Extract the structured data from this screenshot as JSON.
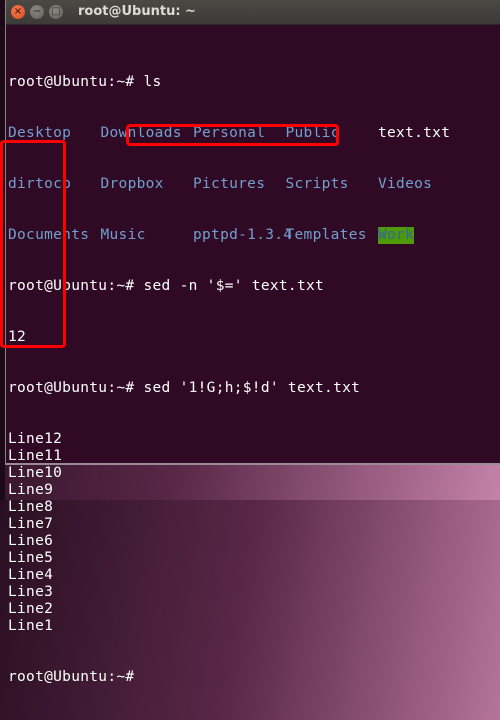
{
  "window": {
    "title": "root@Ubuntu: ~",
    "buttons": {
      "close": "×",
      "minimize": "−",
      "maximize": "□"
    }
  },
  "terminal": {
    "prompt": "root@Ubuntu:~# ",
    "commands": {
      "ls": "ls",
      "count": "sed -n '$=' text.txt",
      "reverse": "sed '1!G;h;$!d' text.txt"
    },
    "ls_output": [
      [
        "Desktop",
        "Downloads",
        "Personal",
        "Public",
        "text.txt"
      ],
      [
        "dirtocp",
        "Dropbox",
        "Pictures",
        "Scripts",
        "Videos"
      ],
      [
        "Documents",
        "Music",
        "pptpd-1.3.4",
        "Templates",
        "Work"
      ]
    ],
    "count_output": "12",
    "reverse_output": [
      "Line12",
      "Line11",
      "Line10",
      "Line9",
      "Line8",
      "Line7",
      "Line6",
      "Line5",
      "Line4",
      "Line3",
      "Line2",
      "Line1"
    ],
    "final_prompt": "root@Ubuntu:~#"
  },
  "colors": {
    "background": "#300a24",
    "directory": "#729fcf",
    "highlight": "#ff0000",
    "work_bg": "#4e9a06"
  }
}
